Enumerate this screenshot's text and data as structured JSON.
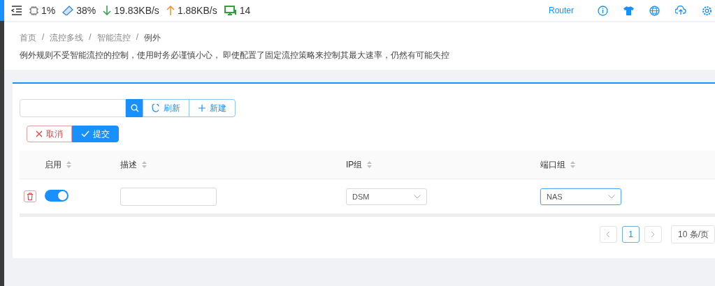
{
  "header": {
    "stats": [
      {
        "kind": "cpu",
        "text": "1%"
      },
      {
        "kind": "memory",
        "text": "38%"
      },
      {
        "kind": "download",
        "text": "19.83KB/s"
      },
      {
        "kind": "upload",
        "text": "1.88KB/s"
      },
      {
        "kind": "devices",
        "text": "14"
      }
    ],
    "router_label": "Router"
  },
  "breadcrumb": [
    "首页",
    "流控多线",
    "智能流控",
    "例外"
  ],
  "breadcrumb_separator": "/",
  "description": "例外规则不受智能流控的控制，使用时务必谨慎小心， 即使配置了固定流控策略来控制其最大速率，仍然有可能失控",
  "toolbar": {
    "refresh": "刷新",
    "new": "新建",
    "cancel": "取消",
    "submit": "提交"
  },
  "table": {
    "columns": [
      {
        "label": "启用"
      },
      {
        "label": "描述"
      },
      {
        "label": "IP组"
      },
      {
        "label": "端口组"
      }
    ],
    "rows": [
      {
        "enabled": true,
        "description": "",
        "ip_group": "DSM",
        "port_group": "NAS",
        "port_focused": true
      }
    ]
  },
  "pagination": {
    "pages": [
      {
        "label": "1",
        "selected": true
      }
    ],
    "page_size": "10 条/页"
  }
}
